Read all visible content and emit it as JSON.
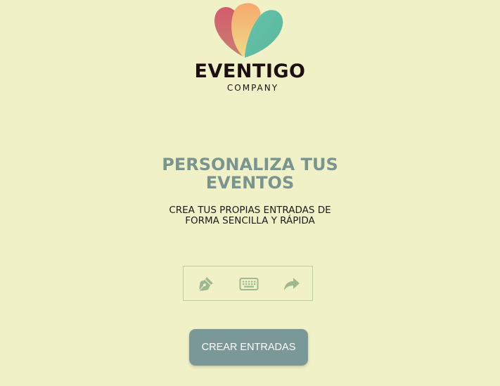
{
  "brand": {
    "name": "EVENTIGO",
    "subtitle": "COMPANY"
  },
  "hero": {
    "title_line1": "PERSONALIZA TUS",
    "title_line2": "EVENTOS",
    "subtitle_line1": "CREA TUS PROPIAS ENTRADAS DE",
    "subtitle_line2": "FORMA SENCILLA Y RÁPIDA"
  },
  "tools": [
    {
      "icon": "pen-nib-icon"
    },
    {
      "icon": "keyboard-icon"
    },
    {
      "icon": "share-arrow-icon"
    }
  ],
  "cta": {
    "label": "CREAR ENTRADAS"
  },
  "colors": {
    "background": "#f1f1c8",
    "accent": "#7a9490",
    "button": "#7a9897",
    "icon": "#9fb88f",
    "logo_red": "#d06c72",
    "logo_orange": "#f5b06e",
    "logo_teal": "#62c1a7"
  }
}
